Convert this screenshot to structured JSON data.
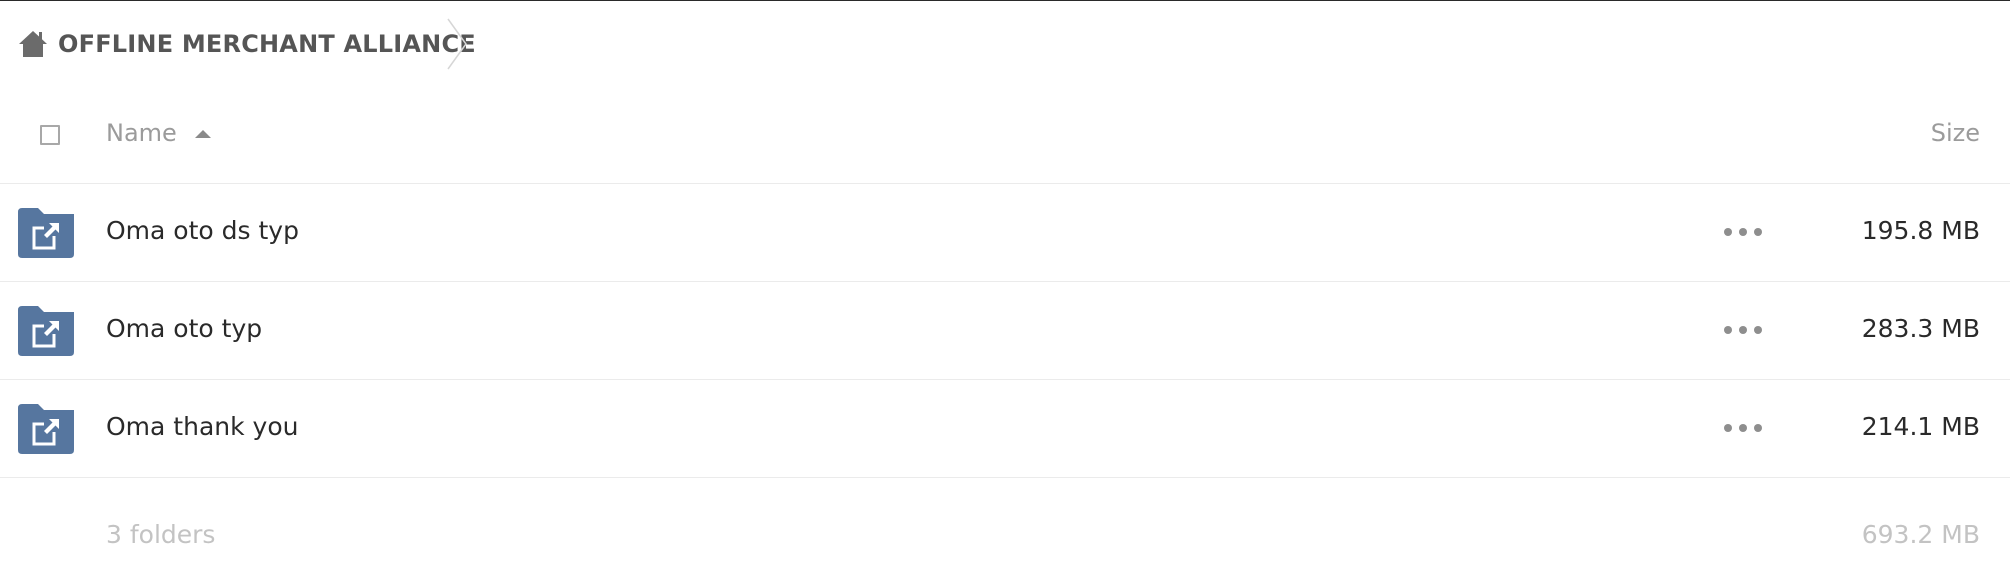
{
  "breadcrumb": {
    "icon": "home-icon",
    "label": "OFFLINE MERCHANT ALLIANCE"
  },
  "table": {
    "headers": {
      "name": "Name",
      "size": "Size",
      "sort_direction": "ascending"
    },
    "rows": [
      {
        "icon": "shared-folder-icon",
        "name": "Oma oto ds typ",
        "size": "195.8 MB"
      },
      {
        "icon": "shared-folder-icon",
        "name": "Oma oto typ",
        "size": "283.3 MB"
      },
      {
        "icon": "shared-folder-icon",
        "name": "Oma thank you",
        "size": "214.1 MB"
      }
    ]
  },
  "footer": {
    "count": "3 folders",
    "total_size": "693.2 MB"
  },
  "colors": {
    "folder_icon": "#56769f",
    "breadcrumb_text": "#555555",
    "header_text": "#9b9b9b",
    "footer_text": "#c3c3c3",
    "row_text": "#2a2a2a",
    "divider": "#ebebeb"
  }
}
